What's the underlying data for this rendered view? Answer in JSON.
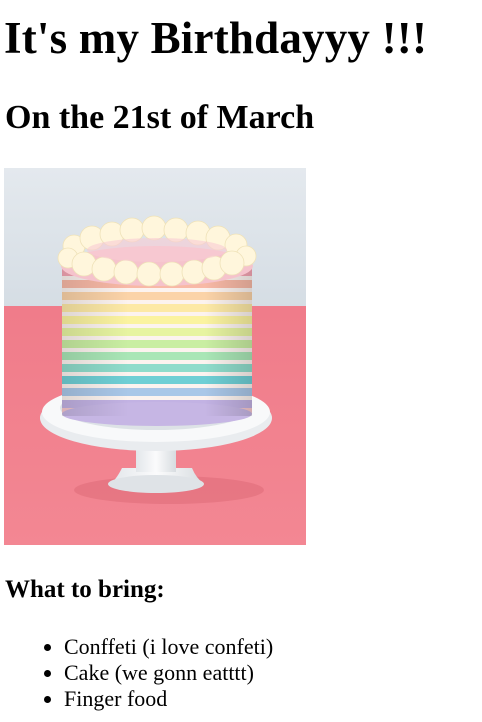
{
  "title": "It's my Birthdayyy !!!",
  "subtitle": "On the 21st of March",
  "image": {
    "subject": "cake-image",
    "colors": {
      "background_top": "#dfe6ec",
      "table": "#f27e8c",
      "stand": "#f2f3f5",
      "frosting": "#fff7dd"
    }
  },
  "list_heading": "What to bring:",
  "items": [
    "Conffeti (i love confeti)",
    "Cake (we gonn eatttt)",
    "Finger food"
  ]
}
